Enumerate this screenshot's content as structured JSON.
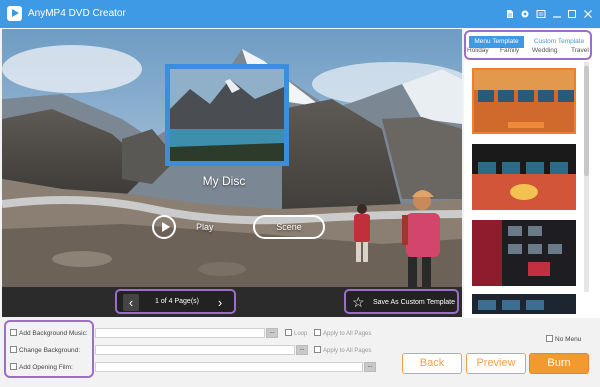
{
  "app": {
    "title": "AnyMP4 DVD Creator"
  },
  "titlebar": {
    "icons": [
      "file-icon",
      "settings-icon",
      "menu-icon",
      "minimize-icon",
      "maximize-icon",
      "close-icon"
    ]
  },
  "preview": {
    "disc_title": "My Disc",
    "play_label": "Play",
    "scene_label": "Scene",
    "page_text": "1 of 4 Page(s)",
    "save_template_label": "Save As Custom Template"
  },
  "templates": {
    "tabs": [
      {
        "label": "Menu Template"
      },
      {
        "label": "Custom Template"
      }
    ],
    "categories": [
      {
        "label": "Holiday"
      },
      {
        "label": "Family"
      },
      {
        "label": "Wedding"
      },
      {
        "label": "Travel"
      }
    ]
  },
  "settings": {
    "background_music": "Add Background Music:",
    "change_background": "Change Background:",
    "opening_film": "Add Opening Film:",
    "loop": "Loop",
    "apply_all_1": "Apply to All Pages",
    "apply_all_2": "Apply to All Pages",
    "browse": "..."
  },
  "options": {
    "no_menu": "No Menu"
  },
  "buttons": {
    "back": "Back",
    "preview": "Preview",
    "burn": "Burn"
  },
  "colors": {
    "accent": "#3f9ae5",
    "highlight": "#9b6fc8",
    "burn": "#f29a30",
    "selected_template": "#f07e2c"
  }
}
